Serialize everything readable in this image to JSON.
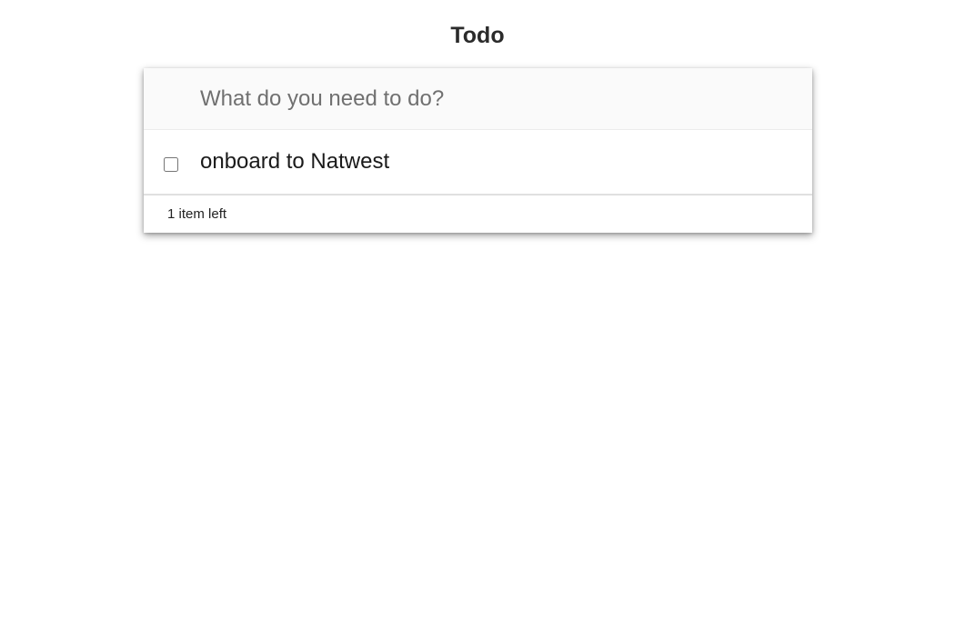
{
  "header": {
    "title": "Todo"
  },
  "new_todo": {
    "placeholder": "What do you need to do?",
    "value": ""
  },
  "todos": [
    {
      "label": "onboard to Natwest",
      "completed": false
    }
  ],
  "footer": {
    "items_left": "1 item left"
  }
}
